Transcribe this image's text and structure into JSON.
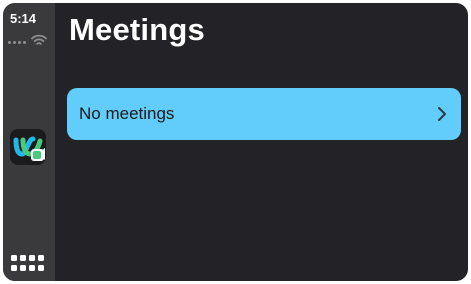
{
  "status_bar": {
    "time": "5:14"
  },
  "sidebar": {
    "app_icon": "webex-app-icon",
    "launcher_icon": "app-grid-icon"
  },
  "header": {
    "title": "Meetings"
  },
  "meetings_list": {
    "items": [
      {
        "label": "No meetings",
        "icon": "chevron-right-icon"
      }
    ]
  },
  "colors": {
    "background": "#232327",
    "sidebar": "#3a3a3c",
    "row_accent": "#62cdfa",
    "text_light": "#ffffff",
    "text_dark": "#1a1a1a"
  }
}
